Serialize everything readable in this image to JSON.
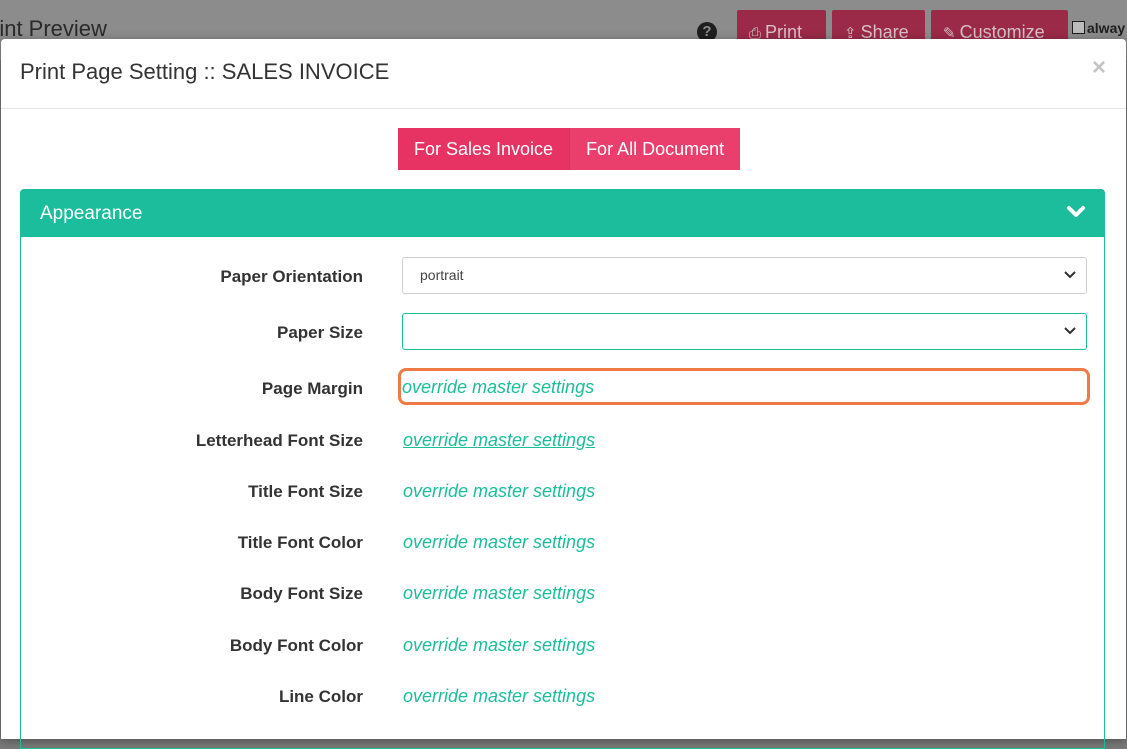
{
  "background": {
    "title": "rint Preview",
    "help_icon": "question-circle-icon",
    "buttons": [
      {
        "label": "Print",
        "icon": "print-icon"
      },
      {
        "label": "Share",
        "icon": "share-icon"
      },
      {
        "label": "Customize",
        "icon": "brush-icon"
      }
    ],
    "checkbox_label": "alway"
  },
  "modal": {
    "title": "Print Page Setting :: SALES INVOICE",
    "close": "×",
    "tabs": [
      {
        "label": "For Sales Invoice",
        "active": true
      },
      {
        "label": "For All Document",
        "active": false
      }
    ],
    "panel": {
      "title": "Appearance",
      "fields": [
        {
          "label": "Paper Orientation",
          "type": "select",
          "value": "portrait"
        },
        {
          "label": "Paper Size",
          "type": "select",
          "value": ""
        },
        {
          "label": "Page Margin",
          "type": "link",
          "value": "override master settings"
        },
        {
          "label": "Letterhead Font Size",
          "type": "link",
          "value": "override master settings"
        },
        {
          "label": "Title Font Size",
          "type": "link",
          "value": "override master settings"
        },
        {
          "label": "Title Font Color",
          "type": "link",
          "value": "override master settings"
        },
        {
          "label": "Body Font Size",
          "type": "link",
          "value": "override master settings"
        },
        {
          "label": "Body Font Color",
          "type": "link",
          "value": "override master settings"
        },
        {
          "label": "Line Color",
          "type": "link",
          "value": "override master settings"
        }
      ]
    }
  },
  "colors": {
    "accent": "#1bbd9c",
    "tab": "#e73364",
    "highlight": "#f07a45"
  }
}
